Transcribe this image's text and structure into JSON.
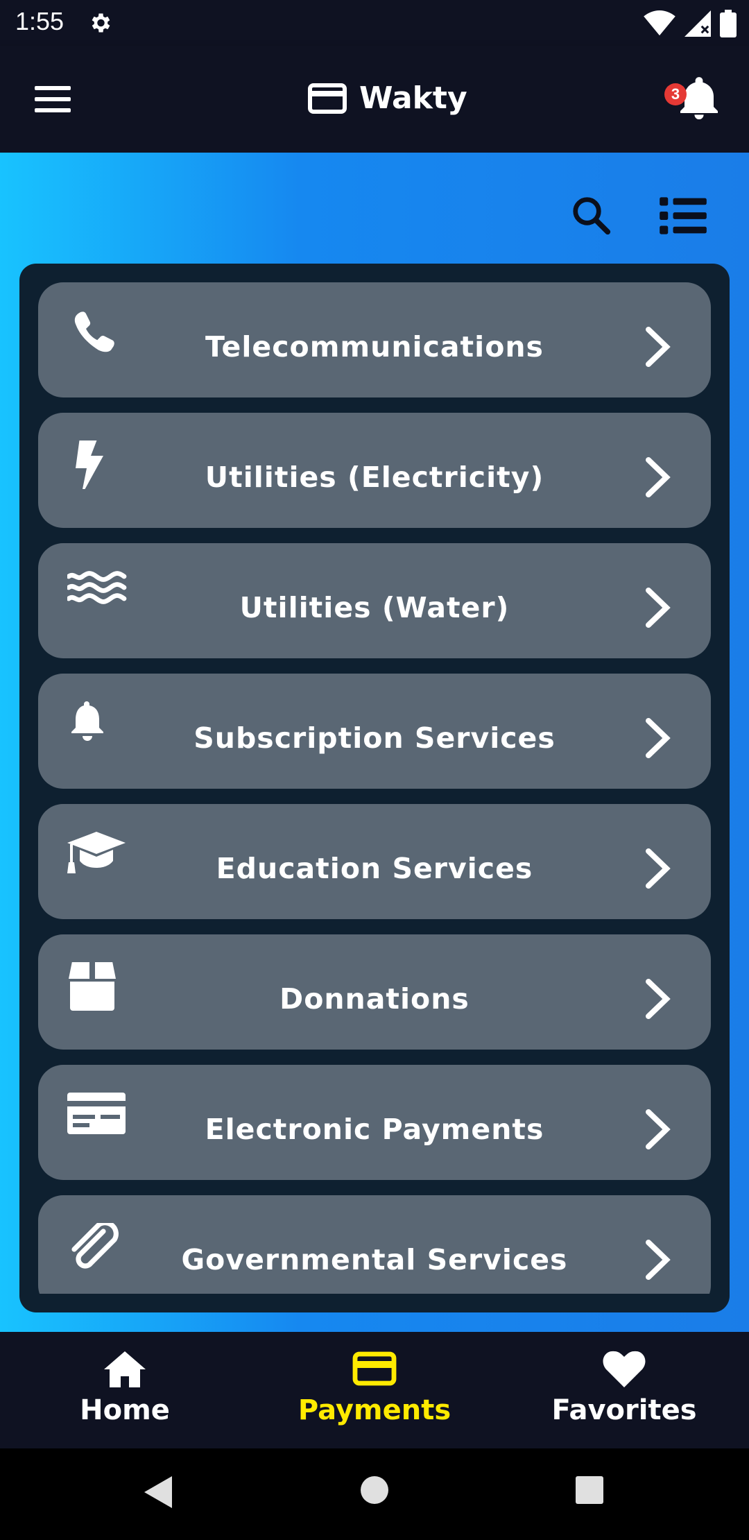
{
  "status_bar": {
    "time": "1:55",
    "icons": [
      "settings-gear-icon",
      "wifi-icon",
      "cell-signal-icon",
      "battery-icon"
    ]
  },
  "app_bar": {
    "title": "Wakty",
    "brand_icon": "credit-card-icon",
    "menu_icon": "hamburger-menu-icon",
    "notification_icon": "bell-icon",
    "notification_count": "3"
  },
  "toolbar": {
    "search_icon": "search-icon",
    "view_icon": "list-view-icon"
  },
  "categories": [
    {
      "label": "Telecommunications",
      "icon": "phone-icon"
    },
    {
      "label": "Utilities (Electricity)",
      "icon": "lightning-bolt-icon"
    },
    {
      "label": "Utilities (Water)",
      "icon": "water-waves-icon"
    },
    {
      "label": "Subscription Services",
      "icon": "bell-icon"
    },
    {
      "label": "Education Services",
      "icon": "graduation-cap-icon"
    },
    {
      "label": "Donnations",
      "icon": "box-icon"
    },
    {
      "label": "Electronic Payments",
      "icon": "credit-card-icon"
    },
    {
      "label": "Governmental Services",
      "icon": "paperclip-icon"
    }
  ],
  "bottom_nav": {
    "items": [
      {
        "label": "Home",
        "icon": "home-icon",
        "active": false
      },
      {
        "label": "Payments",
        "icon": "credit-card-icon",
        "active": true
      },
      {
        "label": "Favorites",
        "icon": "heart-icon",
        "active": false
      }
    ],
    "active_color": "#ffea00",
    "inactive_color": "#ffffff"
  },
  "colors": {
    "app_bar_bg": "#0f1222",
    "gradient_start": "#18c3ff",
    "gradient_end": "#1a7de8",
    "panel_bg": "#0e2030",
    "item_bg": "#5a6774"
  }
}
